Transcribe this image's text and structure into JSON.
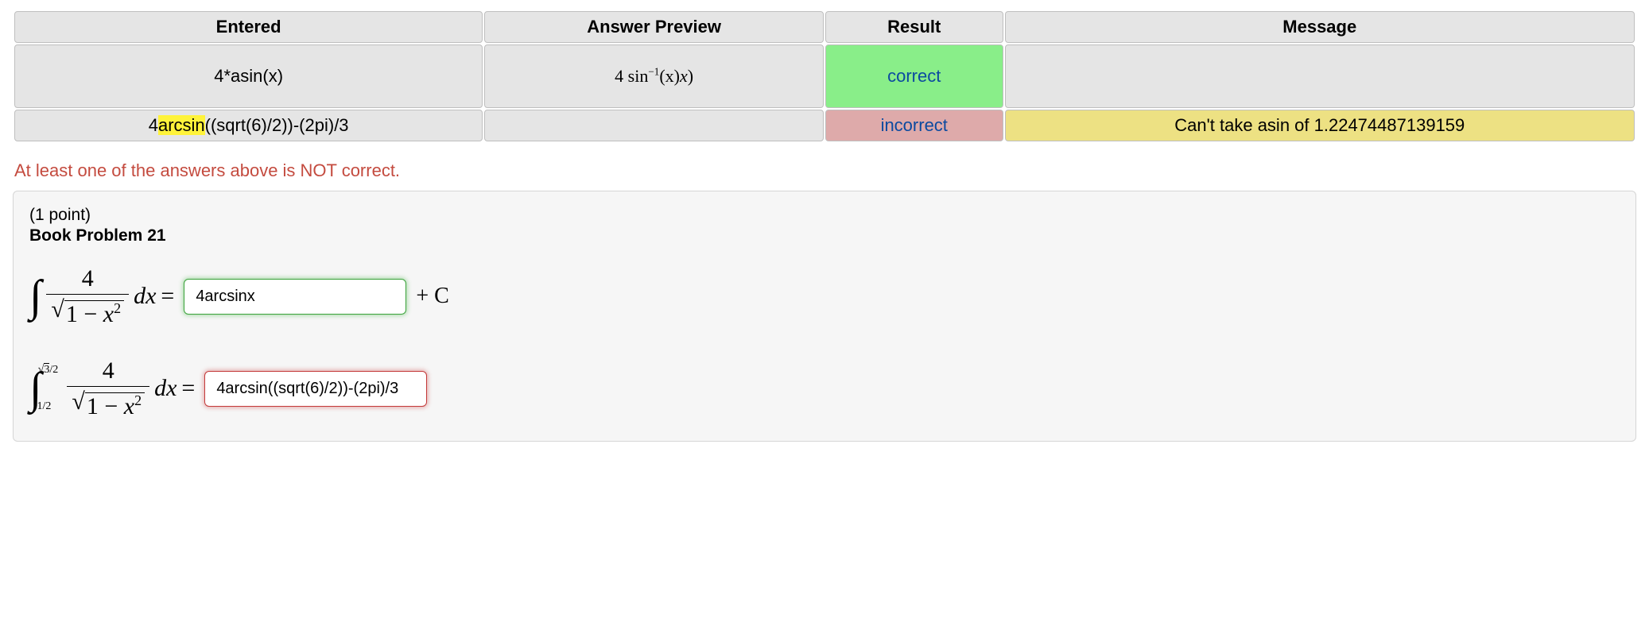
{
  "table": {
    "headers": {
      "entered": "Entered",
      "preview": "Answer Preview",
      "result": "Result",
      "message": "Message"
    },
    "rows": [
      {
        "entered_plain": "4*asin(x)",
        "preview": {
          "prefix": "4 sin",
          "sup": "−1",
          "arg": "(x)"
        },
        "result": "correct",
        "result_kind": "correct",
        "message": ""
      },
      {
        "entered_pre": "4",
        "entered_hl": "arcsin",
        "entered_post": "((sqrt(6)/2))-(2pi)/3",
        "preview": null,
        "result": "incorrect",
        "result_kind": "incorrect",
        "message": "Can't take asin of 1.22474487139159",
        "message_kind": "warn"
      }
    ]
  },
  "status_line": "At least one of the answers above is NOT correct.",
  "problem": {
    "points": "(1 point)",
    "title": "Book Problem 21",
    "q1": {
      "integrand_num": "4",
      "integrand_den_radicand_a": "1 − ",
      "integrand_den_radicand_b": "x",
      "integrand_den_radicand_c": "2",
      "dx": "dx",
      "equals": "=",
      "answer": "4arcsinx",
      "plus_c": "+ C"
    },
    "q2": {
      "lower_bound": "1/2",
      "upper_bound_surd": "3",
      "upper_bound_suffix": "/2",
      "integrand_num": "4",
      "integrand_den_radicand_a": "1 − ",
      "integrand_den_radicand_b": "x",
      "integrand_den_radicand_c": "2",
      "dx": "dx",
      "equals": "=",
      "answer": "4arcsin((sqrt(6)/2))-(2pi)/3"
    }
  }
}
